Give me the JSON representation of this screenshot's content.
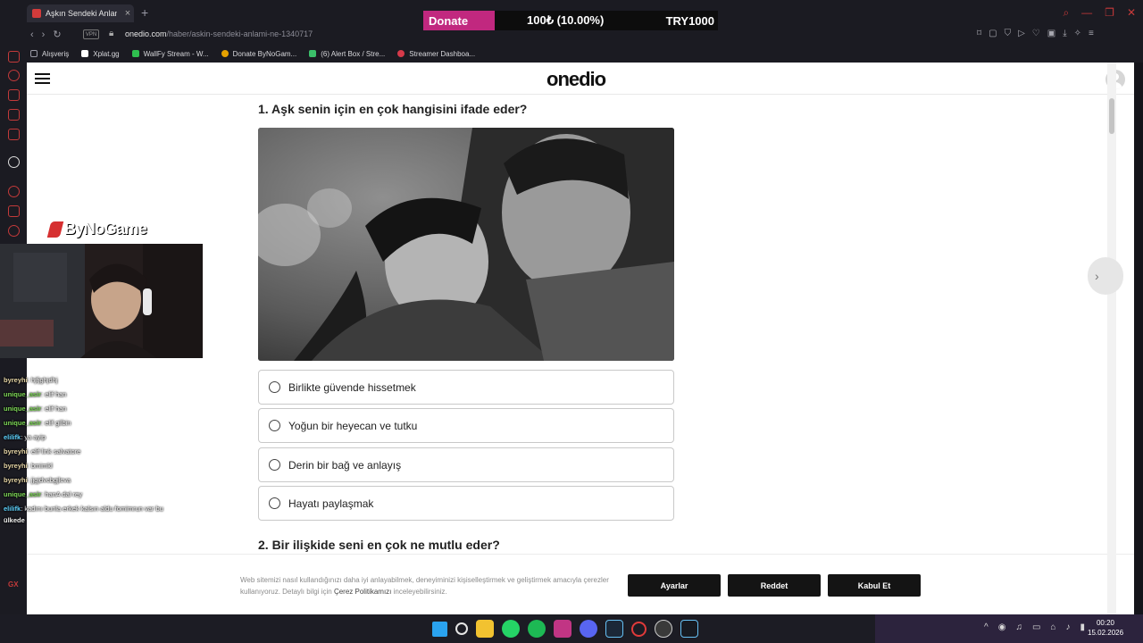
{
  "browser": {
    "tab_title": "Aşkın Sendeki Anlamı Ne?",
    "tab_close": "×",
    "new_tab": "+",
    "url_host": "onedio.com",
    "url_path": "/haber/askin-sendeki-anlami-ne-1340717",
    "vpn_label": "VPN",
    "bookmarks": [
      {
        "label": "Alışveriş",
        "color": "#9a9aa6"
      },
      {
        "label": "Xplat.gg",
        "color": "#ffffff"
      },
      {
        "label": "WallFy Stream - W...",
        "color": "#2fbf4f"
      },
      {
        "label": "Donate ByNoGam...",
        "color": "#e5a100"
      },
      {
        "label": "(6) Alert Box / Stre...",
        "color": "#3bbf6a"
      },
      {
        "label": "Streamer Dashboa...",
        "color": "#d63a4a"
      }
    ]
  },
  "donate": {
    "label": "Donate",
    "amount": "100₺ (10.00%)",
    "goal": "TRY1000",
    "accent": "#c1287f"
  },
  "site": {
    "logo": "onedio"
  },
  "quiz": {
    "q1": {
      "title": "1. Aşk senin için en çok hangisini ifade eder?",
      "options": [
        "Birlikte güvende hissetmek",
        "Yoğun bir heyecan ve tutku",
        "Derin bir bağ ve anlayış",
        "Hayatı paylaşmak"
      ]
    },
    "q2": {
      "title": "2. Bir ilişkide seni en çok ne mutlu eder?"
    }
  },
  "cookie": {
    "text_before": "Web sitemizi nasıl kullandığınızı daha iyi anlayabilmek, deneyiminizi kişiselleştirmek ve geliştirmek amacıyla çerezler kullanıyoruz. Detaylı bilgi için ",
    "link": "Çerez Politikamızı",
    "text_after": " inceleyebilirsiniz.",
    "btn_settings": "Ayarlar",
    "btn_reject": "Reddet",
    "btn_accept": "Kabul Et"
  },
  "stream": {
    "brand": "ByNoGame",
    "chat": [
      {
        "user": "byreyhi",
        "msg": "hjfjghjdhj",
        "color": "#e8d7a8"
      },
      {
        "user": "unique_asir",
        "msg": "elif han",
        "color": "#7ed957"
      },
      {
        "user": "unique_asir",
        "msg": "elif han",
        "color": "#7ed957"
      },
      {
        "user": "unique_asir",
        "msg": "elif gilbin",
        "color": "#7ed957"
      },
      {
        "user": "elilifk",
        "msg": "ya ayip",
        "color": "#5fd4ff"
      },
      {
        "user": "byreyhi",
        "msg": "elif link salvatore",
        "color": "#e8d7a8"
      },
      {
        "user": "byreyhi",
        "msg": "bmimkl",
        "color": "#e8d7a8"
      },
      {
        "user": "byreyhi",
        "msg": "jjgjdvcbgjlcva",
        "color": "#e8d7a8"
      },
      {
        "user": "unique_asir",
        "msg": "hanA dal rey",
        "color": "#7ed957"
      },
      {
        "user": "elilifk",
        "msg": "kadını bunla erkek kalsın aldu fomimrun var bu",
        "color": "#5fd4ff"
      },
      {
        "user": "",
        "msg": "ülkede",
        "color": "#ffffff"
      }
    ]
  },
  "taskbar": {
    "time": "00:20",
    "date": "15.02.2026",
    "sidebar_label": "GX"
  }
}
